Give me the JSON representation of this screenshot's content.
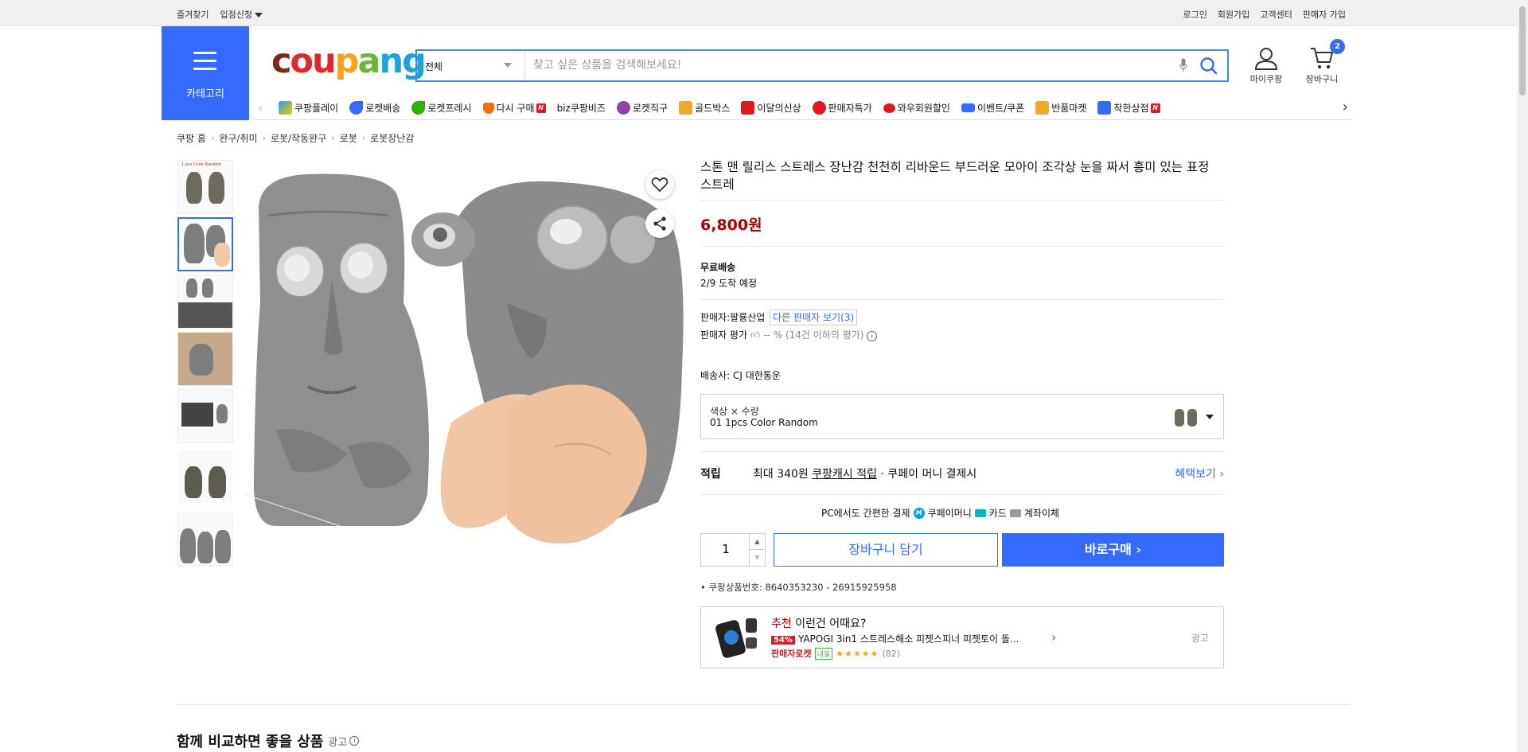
{
  "topbar": {
    "left": [
      {
        "label": "즐겨찾기"
      },
      {
        "label": "입점신청"
      }
    ],
    "right": [
      {
        "label": "로그인"
      },
      {
        "label": "회원가입"
      },
      {
        "label": "고객센터"
      },
      {
        "label": "판매자 가입"
      }
    ]
  },
  "header": {
    "category_label": "카테고리",
    "logo": {
      "c": "c",
      "ou": "ou",
      "p": "p",
      "a": "a",
      "n": "n",
      "g": "g"
    },
    "search": {
      "category": "전체",
      "placeholder": "찾고 싶은 상품을 검색해보세요!"
    },
    "mycoupang_label": "마이쿠팡",
    "cart_label": "장바구니",
    "cart_count": "2"
  },
  "nav": {
    "items": [
      {
        "label": "쿠팡플레이",
        "color": "#1ea7e1"
      },
      {
        "label": "로켓배송",
        "color": "#346aff"
      },
      {
        "label": "로켓프레시",
        "color": "#2db400"
      },
      {
        "label": "다시 구매",
        "color": "#ff6b00",
        "badge": "N"
      },
      {
        "label": "biz쿠팡비즈",
        "color": ""
      },
      {
        "label": "로켓직구",
        "color": "#8e44ad"
      },
      {
        "label": "골드박스",
        "color": "#f5a623"
      },
      {
        "label": "이달의신상",
        "color": "#e5161e"
      },
      {
        "label": "판매자특가",
        "color": "#e5161e"
      },
      {
        "label": "와우회원할인",
        "color": "#e5161e"
      },
      {
        "label": "이벤트/쿠폰",
        "color": "#346aff"
      },
      {
        "label": "반품마켓",
        "color": "#f5a623"
      },
      {
        "label": "착한상점",
        "color": "#346aff",
        "badge": "N"
      }
    ]
  },
  "breadcrumb": [
    "쿠팡 홈",
    "완구/취미",
    "로봇/작동완구",
    "로봇",
    "로봇장난감"
  ],
  "product": {
    "title": "스톤 맨 릴리스 스트레스 장난감 천천히 리바운드 부드러운 모아이 조각상 눈을 짜서 흥미 있는 표정 스트레",
    "price": "6,800원",
    "shipping_title": "무료배송",
    "arrival": "2/9 도착 예정",
    "seller_label": "판매자:",
    "seller_name": "팔룡산업",
    "other_sellers": "다른 판매자 보기(3)",
    "seller_rating_label": "판매자 평가",
    "seller_rating_value": "-- %",
    "seller_rating_note": "(14건 이하의 평가)",
    "courier": "배송사:  CJ 대한통운",
    "option_label": "색상 × 수량",
    "option_value": "01 1pcs Color Random",
    "reward_label": "적립",
    "reward_text_pre": "최대 340원 ",
    "reward_link": "쿠팡캐시 적립",
    "reward_text_post": " · 쿠페이 머니 결제시",
    "reward_more": "혜택보기 ›",
    "pay_intro": "PC에서도 간편한 결제",
    "pay_coupay": "쿠페이머니",
    "pay_card": "카드",
    "pay_bank": "계좌이체",
    "quantity": "1",
    "add_cart": "장바구니 담기",
    "buy_now": "바로구매 ›",
    "product_no": "쿠팡상품번호: 8640353230 - 26915925958",
    "thumb_caption": "1 pcs  Color Random"
  },
  "reco": {
    "head_red": "추천",
    "head_rest": " 이런건 어때요?",
    "discount": "54%",
    "name": "YAPOGI 3in1 스트레스해소 피젯스피너 피젯토이 돌...",
    "seller_rocket": "판매자로켓",
    "tomorrow": "내일",
    "stars": "★★★★★",
    "reviews": "(82)",
    "ad": "광고"
  },
  "compare": {
    "title": "함께 비교하면 좋을 상품",
    "ad": "광고"
  }
}
